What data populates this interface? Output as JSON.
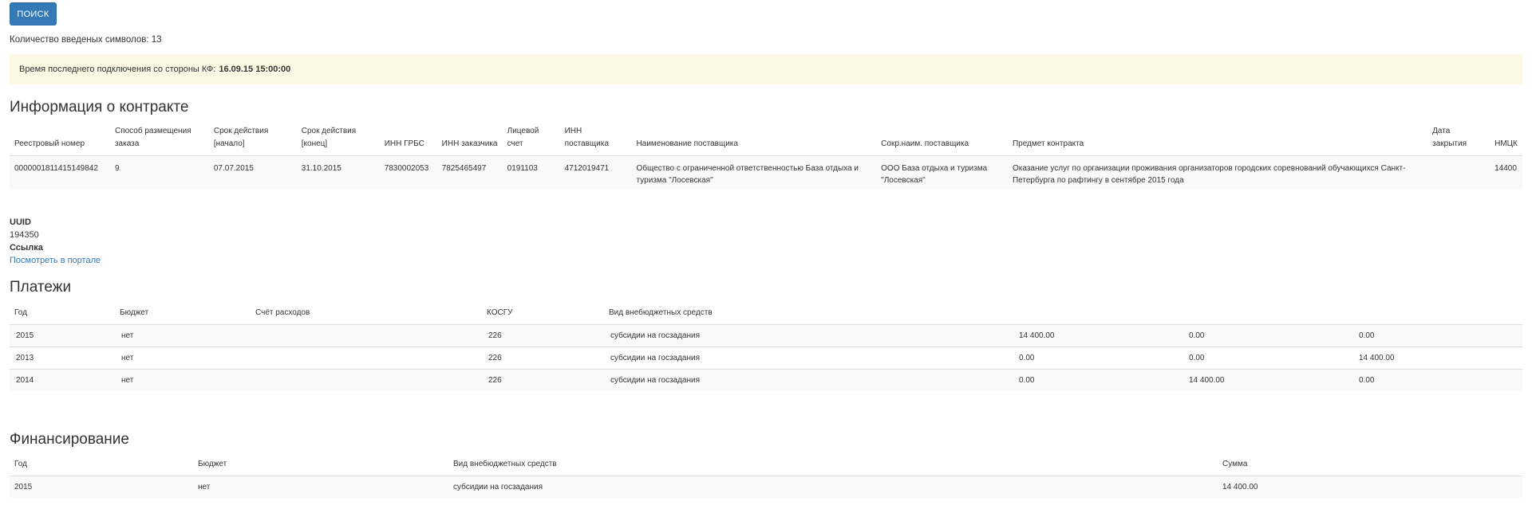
{
  "toolbar": {
    "search_label": "ПОИСК"
  },
  "char_count": "Количество введеных символов: 13",
  "alert": {
    "label": "Время последнего подключения со стороны КФ:",
    "value": "16.09.15 15:00:00"
  },
  "contract": {
    "title": "Информация о контракте",
    "headers": [
      "Реестровый номер",
      "Способ размещения заказа",
      "Срок действия [начало]",
      "Срок действия [конец]",
      "ИНН ГРБС",
      "ИНН заказчика",
      "Лицевой счет",
      "ИНН поставщика",
      "Наименование поставщика",
      "Сокр.наим. поставщика",
      "Предмет контракта",
      "Дата закрытия",
      "НМЦК"
    ],
    "row": [
      "0000001811415149842",
      "9",
      "07.07.2015",
      "31.10.2015",
      "7830002053",
      "7825465497",
      "0191103",
      "4712019471",
      "Общество с ограниченной ответственностью База отдыха и туризма \"Лосевская\"",
      "ООО База отдыха и туризма \"Лосевская\"",
      "Оказание услуг по организации проживания организаторов городских соревнований обучающихся Санкт-Петербурга по рафтингу в сентябре 2015 года",
      "",
      "14400"
    ]
  },
  "meta": {
    "uuid_label": "UUID",
    "uuid_value": "194350",
    "link_label": "Ссылка",
    "link_text": "Посмотреть в портале"
  },
  "payments": {
    "title": "Платежи",
    "headers": [
      "Год",
      "Бюджет",
      "Счёт расходов",
      "КОСГУ",
      "Вид внебюджетных средств",
      "",
      "",
      ""
    ],
    "rows": [
      [
        "2015",
        "нет",
        "",
        "226",
        "субсидии на госзадания",
        "14 400.00",
        "0.00",
        "0.00"
      ],
      [
        "2013",
        "нет",
        "",
        "226",
        "субсидии на госзадания",
        "0.00",
        "0.00",
        "14 400.00"
      ],
      [
        "2014",
        "нет",
        "",
        "226",
        "субсидии на госзадания",
        "0.00",
        "14 400.00",
        "0.00"
      ]
    ]
  },
  "funding": {
    "title": "Финансирование",
    "headers": [
      "Год",
      "Бюджет",
      "Вид внебюджетных средств",
      "Сумма"
    ],
    "rows": [
      [
        "2015",
        "нет",
        "субсидии на госзадания",
        "14 400.00"
      ]
    ]
  }
}
